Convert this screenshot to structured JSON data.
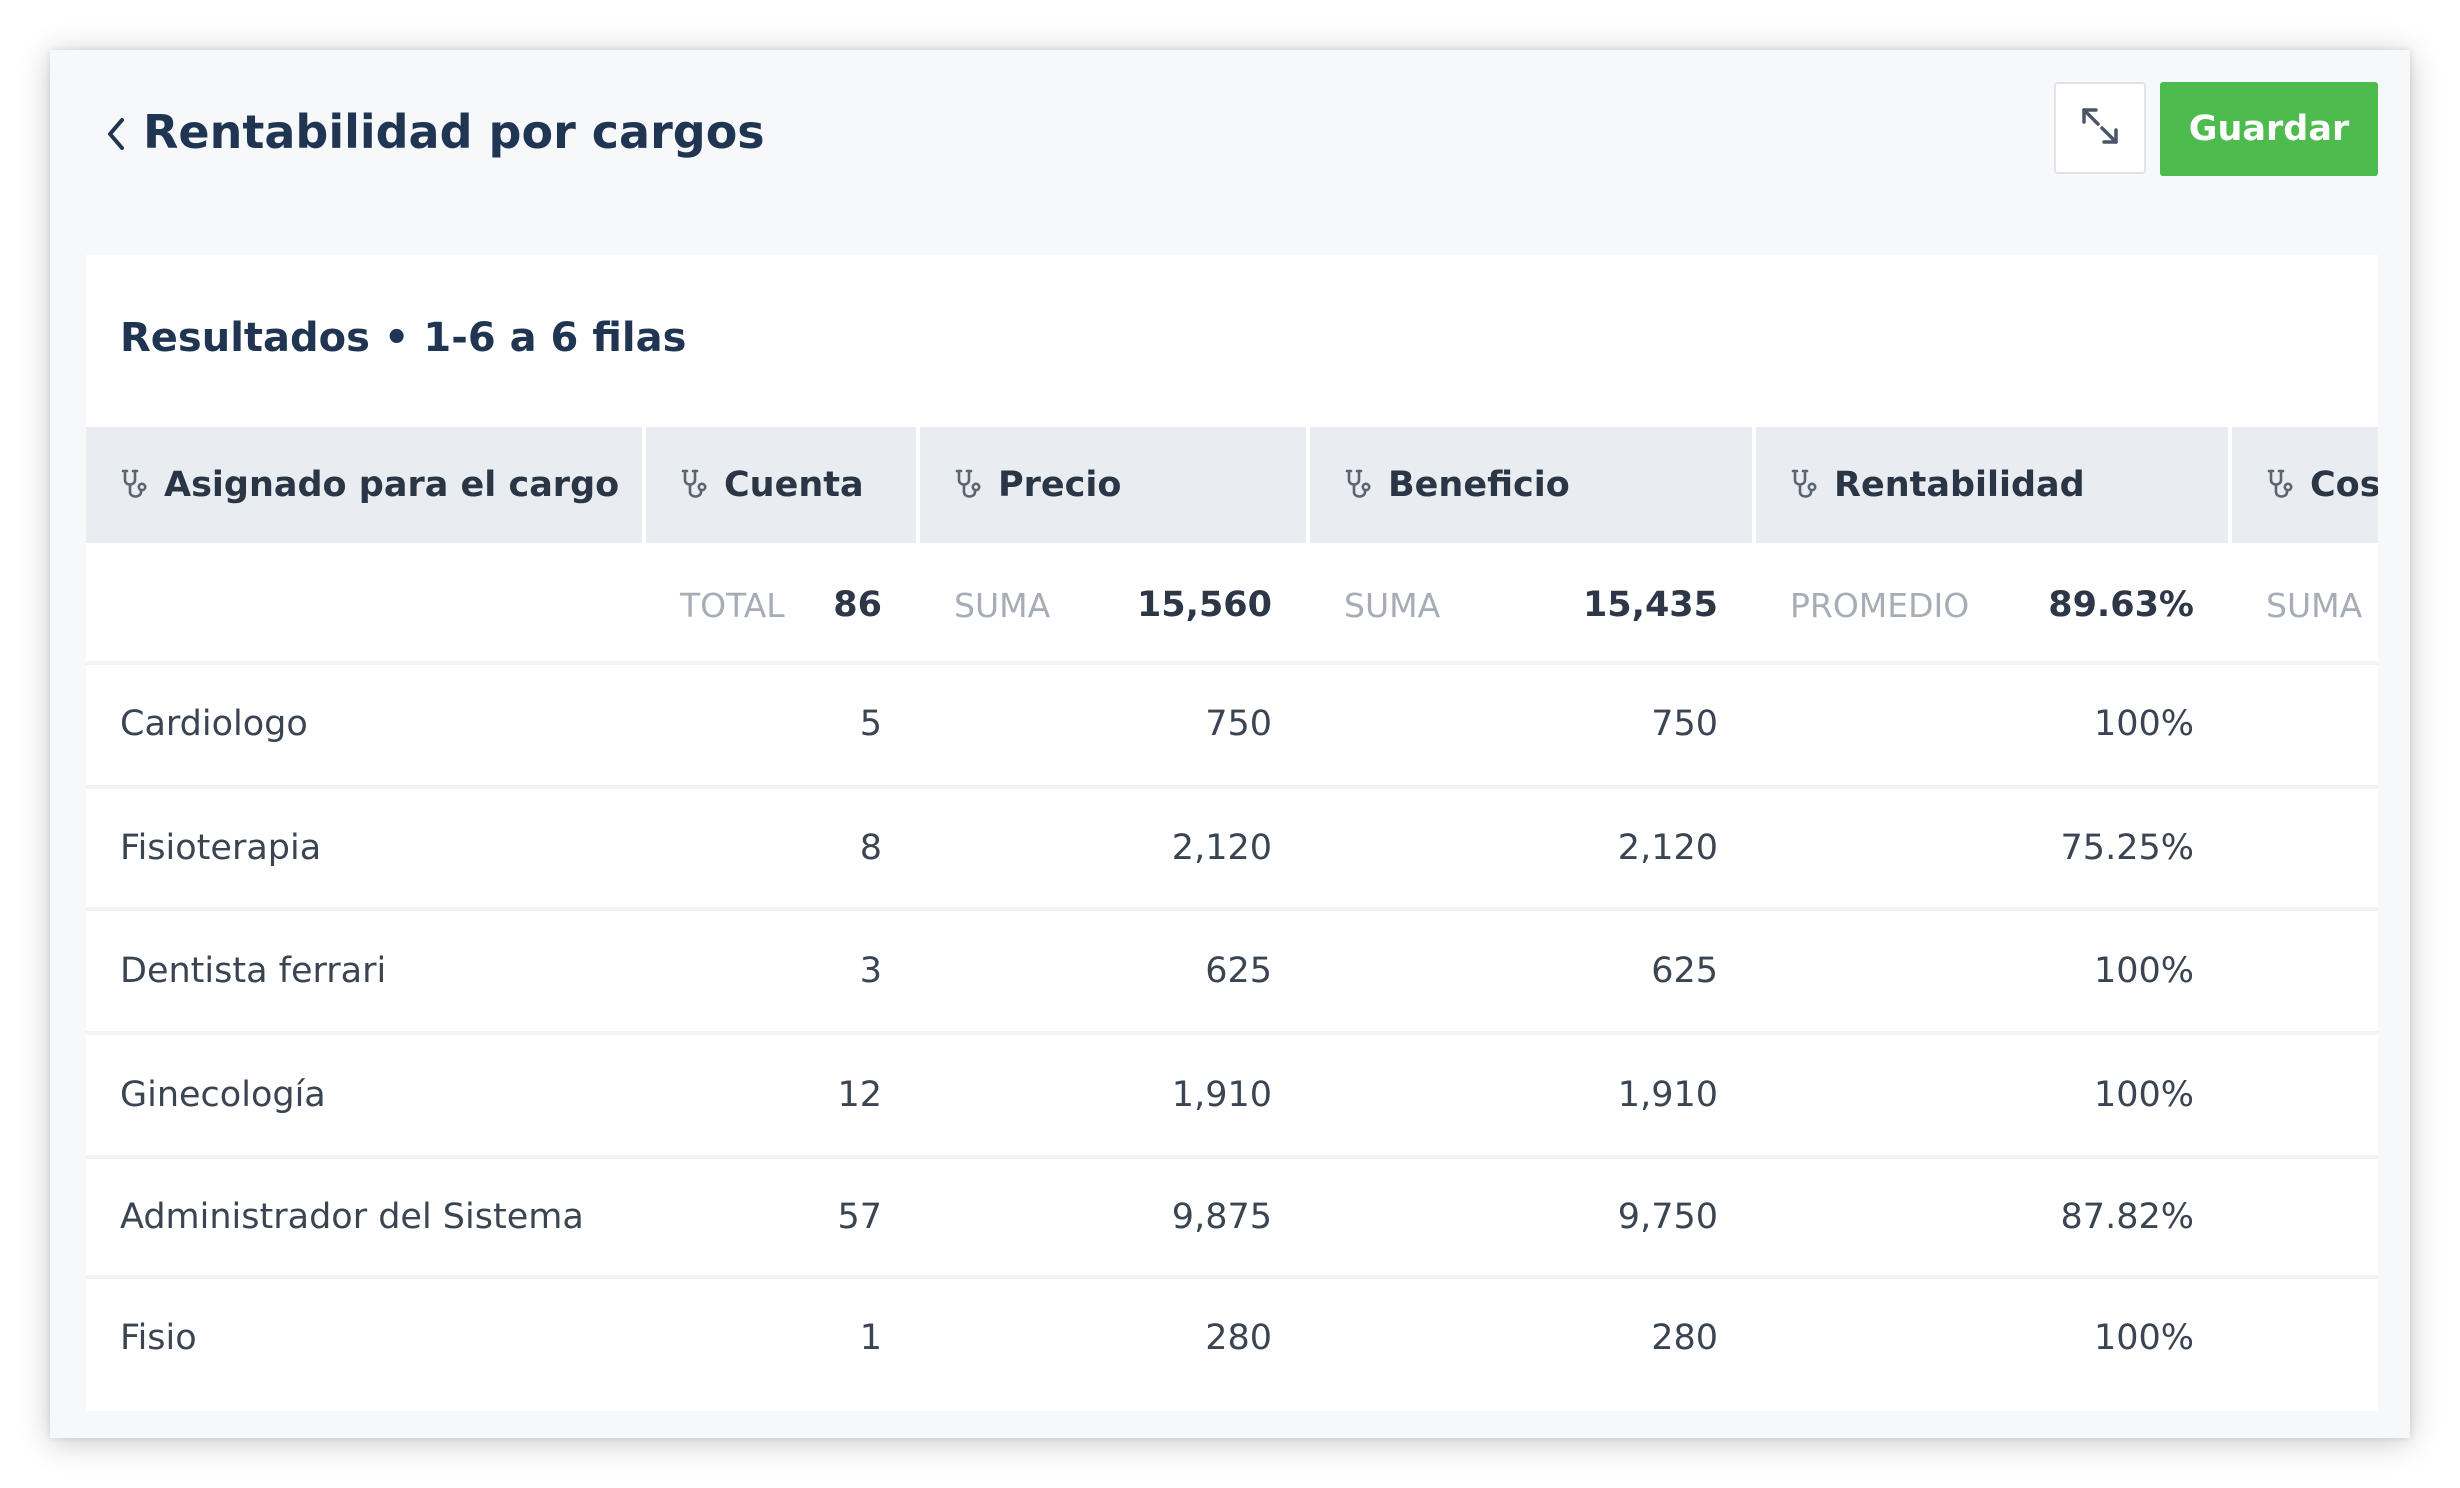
{
  "header": {
    "title": "Rentabilidad por cargos",
    "save_label": "Guardar"
  },
  "results": {
    "title": "Resultados • 1-6 a 6 filas"
  },
  "table": {
    "columns": [
      {
        "label": "Asignado para el cargo",
        "summary_label": "",
        "summary_value": ""
      },
      {
        "label": "Cuenta",
        "summary_label": "TOTAL",
        "summary_value": "86"
      },
      {
        "label": "Precio",
        "summary_label": "SUMA",
        "summary_value": "15,560"
      },
      {
        "label": "Beneficio",
        "summary_label": "SUMA",
        "summary_value": "15,435"
      },
      {
        "label": "Rentabilidad",
        "summary_label": "PROMEDIO",
        "summary_value": "89.63%"
      },
      {
        "label": "Cost",
        "summary_label": "SUMA",
        "summary_value": ""
      }
    ],
    "rows": [
      [
        "Cardiologo",
        "5",
        "750",
        "750",
        "100%",
        ""
      ],
      [
        "Fisioterapia",
        "8",
        "2,120",
        "2,120",
        "75.25%",
        ""
      ],
      [
        "Dentista ferrari",
        "3",
        "625",
        "625",
        "100%",
        ""
      ],
      [
        "Ginecología",
        "12",
        "1,910",
        "1,910",
        "100%",
        ""
      ],
      [
        "Administrador del Sistema",
        "57",
        "9,875",
        "9,750",
        "87.82%",
        ""
      ],
      [
        "Fisio",
        "1",
        "280",
        "280",
        "100%",
        ""
      ]
    ]
  },
  "icons": {
    "back": "chevron-left-icon",
    "expand": "expand-arrows-icon",
    "column": "stethoscope-icon"
  },
  "colors": {
    "title": "#1f3552",
    "save_button": "#4ebb4e",
    "header_bg": "#e9ecf0",
    "summary_label": "#a6adb6"
  }
}
